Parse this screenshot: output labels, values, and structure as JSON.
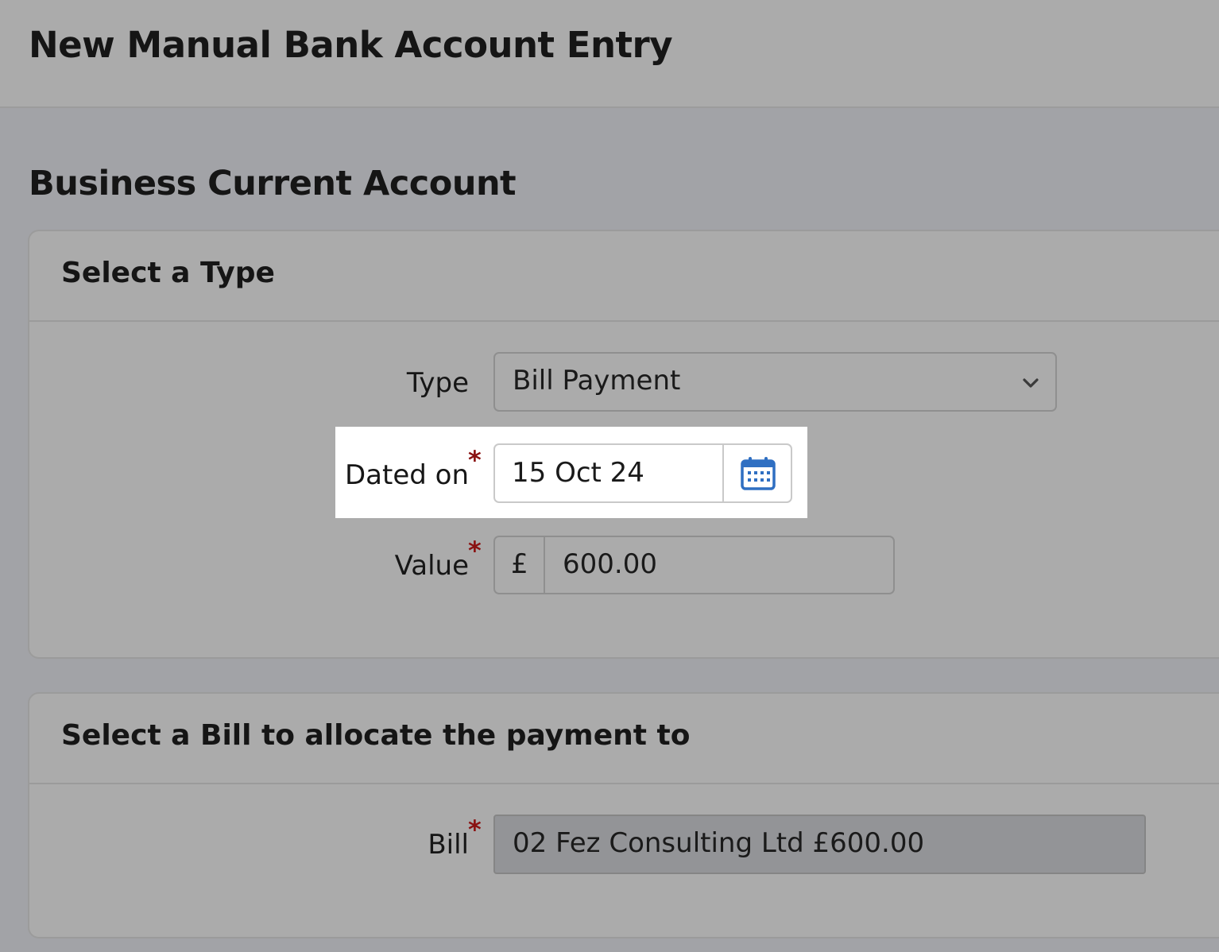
{
  "header": {
    "title": "New Manual Bank Account Entry"
  },
  "account": {
    "name": "Business Current Account"
  },
  "type_panel": {
    "heading": "Select a Type",
    "type": {
      "label": "Type",
      "value": "Bill Payment"
    },
    "dated_on": {
      "label": "Dated on",
      "required_marker": "*",
      "value": "15 Oct 24"
    },
    "value": {
      "label": "Value",
      "required_marker": "*",
      "currency": "£",
      "amount": "600.00"
    }
  },
  "bill_panel": {
    "heading": "Select a Bill to allocate the payment to",
    "bill": {
      "label": "Bill",
      "required_marker": "*",
      "value": "02 Fez Consulting Ltd £600.00"
    }
  },
  "icons": {
    "type_dropdown": "chevron-down-icon",
    "date_picker": "calendar-icon"
  },
  "colors": {
    "required": "#8a1212",
    "calendar_icon": "#2f6fc2",
    "highlight": "#ffffff"
  }
}
